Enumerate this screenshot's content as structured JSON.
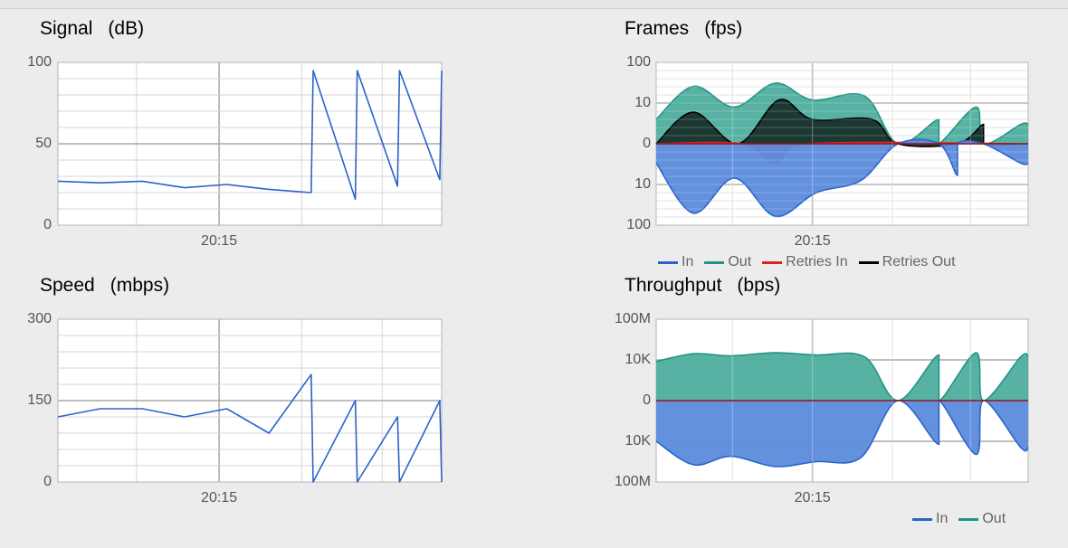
{
  "colors": {
    "in": "#2a63cc",
    "out": "#1f9583",
    "retries_in": "#e51d26",
    "retries_out": "#000000",
    "in_fill": "#5b8bdc",
    "out_fill": "#4fae9f"
  },
  "chart_data": [
    {
      "id": "signal",
      "type": "line",
      "title": "Signal",
      "unit": "(dB)",
      "xlabel": "",
      "ylabel": "",
      "x_tick_labels": [
        "20:15"
      ],
      "y_tick_labels": [
        "100",
        "50",
        "0"
      ],
      "ylim": [
        0,
        100
      ],
      "grid": true,
      "series": [
        {
          "color": "#2a63cc",
          "points": [
            [
              0,
              27
            ],
            [
              0.11,
              26
            ],
            [
              0.22,
              27
            ],
            [
              0.33,
              23
            ],
            [
              0.44,
              25
            ],
            [
              0.55,
              22
            ],
            [
              0.66,
              20
            ],
            [
              0.665,
              95
            ],
            [
              0.775,
              16
            ],
            [
              0.78,
              95
            ],
            [
              0.885,
              24
            ],
            [
              0.89,
              95
            ],
            [
              0.995,
              28
            ],
            [
              1.0,
              95
            ]
          ]
        }
      ]
    },
    {
      "id": "frames",
      "type": "area",
      "title": "Frames",
      "unit": "(fps)",
      "xlabel": "",
      "ylabel": "",
      "x_tick_labels": [
        "20:15"
      ],
      "y_tick_labels": [
        "100",
        "10",
        "0",
        "10",
        "100"
      ],
      "y_scale": "symmetric-log",
      "ylim": [
        -100,
        100
      ],
      "grid": true,
      "legend": [
        "In",
        "Out",
        "Retries In",
        "Retries Out"
      ],
      "legend_position": "bottom",
      "series": [
        {
          "name": "Out",
          "direction": "up",
          "points": [
            [
              0,
              3
            ],
            [
              0.1,
              25
            ],
            [
              0.21,
              7
            ],
            [
              0.32,
              30
            ],
            [
              0.42,
              11
            ],
            [
              0.56,
              14
            ],
            [
              0.65,
              0
            ],
            [
              0.76,
              3
            ],
            [
              0.76,
              0
            ],
            [
              0.86,
              7
            ],
            [
              0.88,
              0
            ],
            [
              0.98,
              2
            ],
            [
              1.0,
              2
            ]
          ]
        },
        {
          "name": "Retries Out",
          "direction": "up",
          "points": [
            [
              0,
              0
            ],
            [
              0.1,
              5
            ],
            [
              0.22,
              0
            ],
            [
              0.33,
              11
            ],
            [
              0.42,
              3
            ],
            [
              0.58,
              3
            ],
            [
              0.65,
              0
            ],
            [
              0.81,
              0
            ],
            [
              0.88,
              2
            ],
            [
              0.88,
              0
            ],
            [
              1.0,
              0
            ]
          ]
        },
        {
          "name": "Retries In",
          "direction": "down",
          "points": [
            [
              0,
              0
            ],
            [
              0.23,
              0
            ],
            [
              0.32,
              2
            ],
            [
              0.41,
              0
            ],
            [
              1.0,
              0
            ]
          ]
        },
        {
          "name": "In",
          "direction": "down",
          "points": [
            [
              0,
              2
            ],
            [
              0.1,
              50
            ],
            [
              0.21,
              6
            ],
            [
              0.32,
              60
            ],
            [
              0.43,
              15
            ],
            [
              0.55,
              7
            ],
            [
              0.65,
              0
            ],
            [
              0.76,
              0
            ],
            [
              0.81,
              5
            ],
            [
              0.81,
              0
            ],
            [
              0.88,
              0
            ],
            [
              0.98,
              2
            ],
            [
              1.0,
              2
            ]
          ]
        }
      ]
    },
    {
      "id": "speed",
      "type": "line",
      "title": "Speed",
      "unit": "(mbps)",
      "xlabel": "",
      "ylabel": "",
      "x_tick_labels": [
        "20:15"
      ],
      "y_tick_labels": [
        "300",
        "150",
        "0"
      ],
      "ylim": [
        0,
        300
      ],
      "grid": true,
      "series": [
        {
          "color": "#2a63cc",
          "points": [
            [
              0,
              120
            ],
            [
              0.11,
              135
            ],
            [
              0.22,
              135
            ],
            [
              0.33,
              120
            ],
            [
              0.44,
              135
            ],
            [
              0.55,
              90
            ],
            [
              0.66,
              198
            ],
            [
              0.665,
              0
            ],
            [
              0.775,
              150
            ],
            [
              0.78,
              0
            ],
            [
              0.885,
              120
            ],
            [
              0.89,
              0
            ],
            [
              0.995,
              150
            ],
            [
              1.0,
              0
            ]
          ]
        }
      ]
    },
    {
      "id": "throughput",
      "type": "area",
      "title": "Throughput",
      "unit": "(bps)",
      "xlabel": "",
      "ylabel": "",
      "x_tick_labels": [
        "20:15"
      ],
      "y_tick_labels": [
        "100M",
        "10K",
        "0",
        "10K",
        "100M"
      ],
      "y_scale": "symmetric-log",
      "ylim": [
        -100000000,
        100000000
      ],
      "grid": true,
      "legend": [
        "In",
        "Out"
      ],
      "legend_position": "bottom-right",
      "series": [
        {
          "name": "Out",
          "direction": "up",
          "points": [
            [
              0,
              7000
            ],
            [
              0.1,
              40000
            ],
            [
              0.2,
              25000
            ],
            [
              0.32,
              50000
            ],
            [
              0.43,
              30000
            ],
            [
              0.56,
              20000
            ],
            [
              0.65,
              0
            ],
            [
              0.76,
              30000
            ],
            [
              0.76,
              0
            ],
            [
              0.86,
              50000
            ],
            [
              0.88,
              0
            ],
            [
              0.98,
              20000
            ],
            [
              1.0,
              20000
            ]
          ]
        },
        {
          "name": "In",
          "direction": "down",
          "points": [
            [
              0,
              10000
            ],
            [
              0.1,
              2000000
            ],
            [
              0.2,
              300000
            ],
            [
              0.32,
              3000000
            ],
            [
              0.43,
              1000000
            ],
            [
              0.55,
              400000
            ],
            [
              0.65,
              0
            ],
            [
              0.76,
              20000
            ],
            [
              0.76,
              0
            ],
            [
              0.86,
              200000
            ],
            [
              0.88,
              0
            ],
            [
              0.98,
              40000
            ],
            [
              1.0,
              40000
            ]
          ]
        }
      ]
    }
  ]
}
